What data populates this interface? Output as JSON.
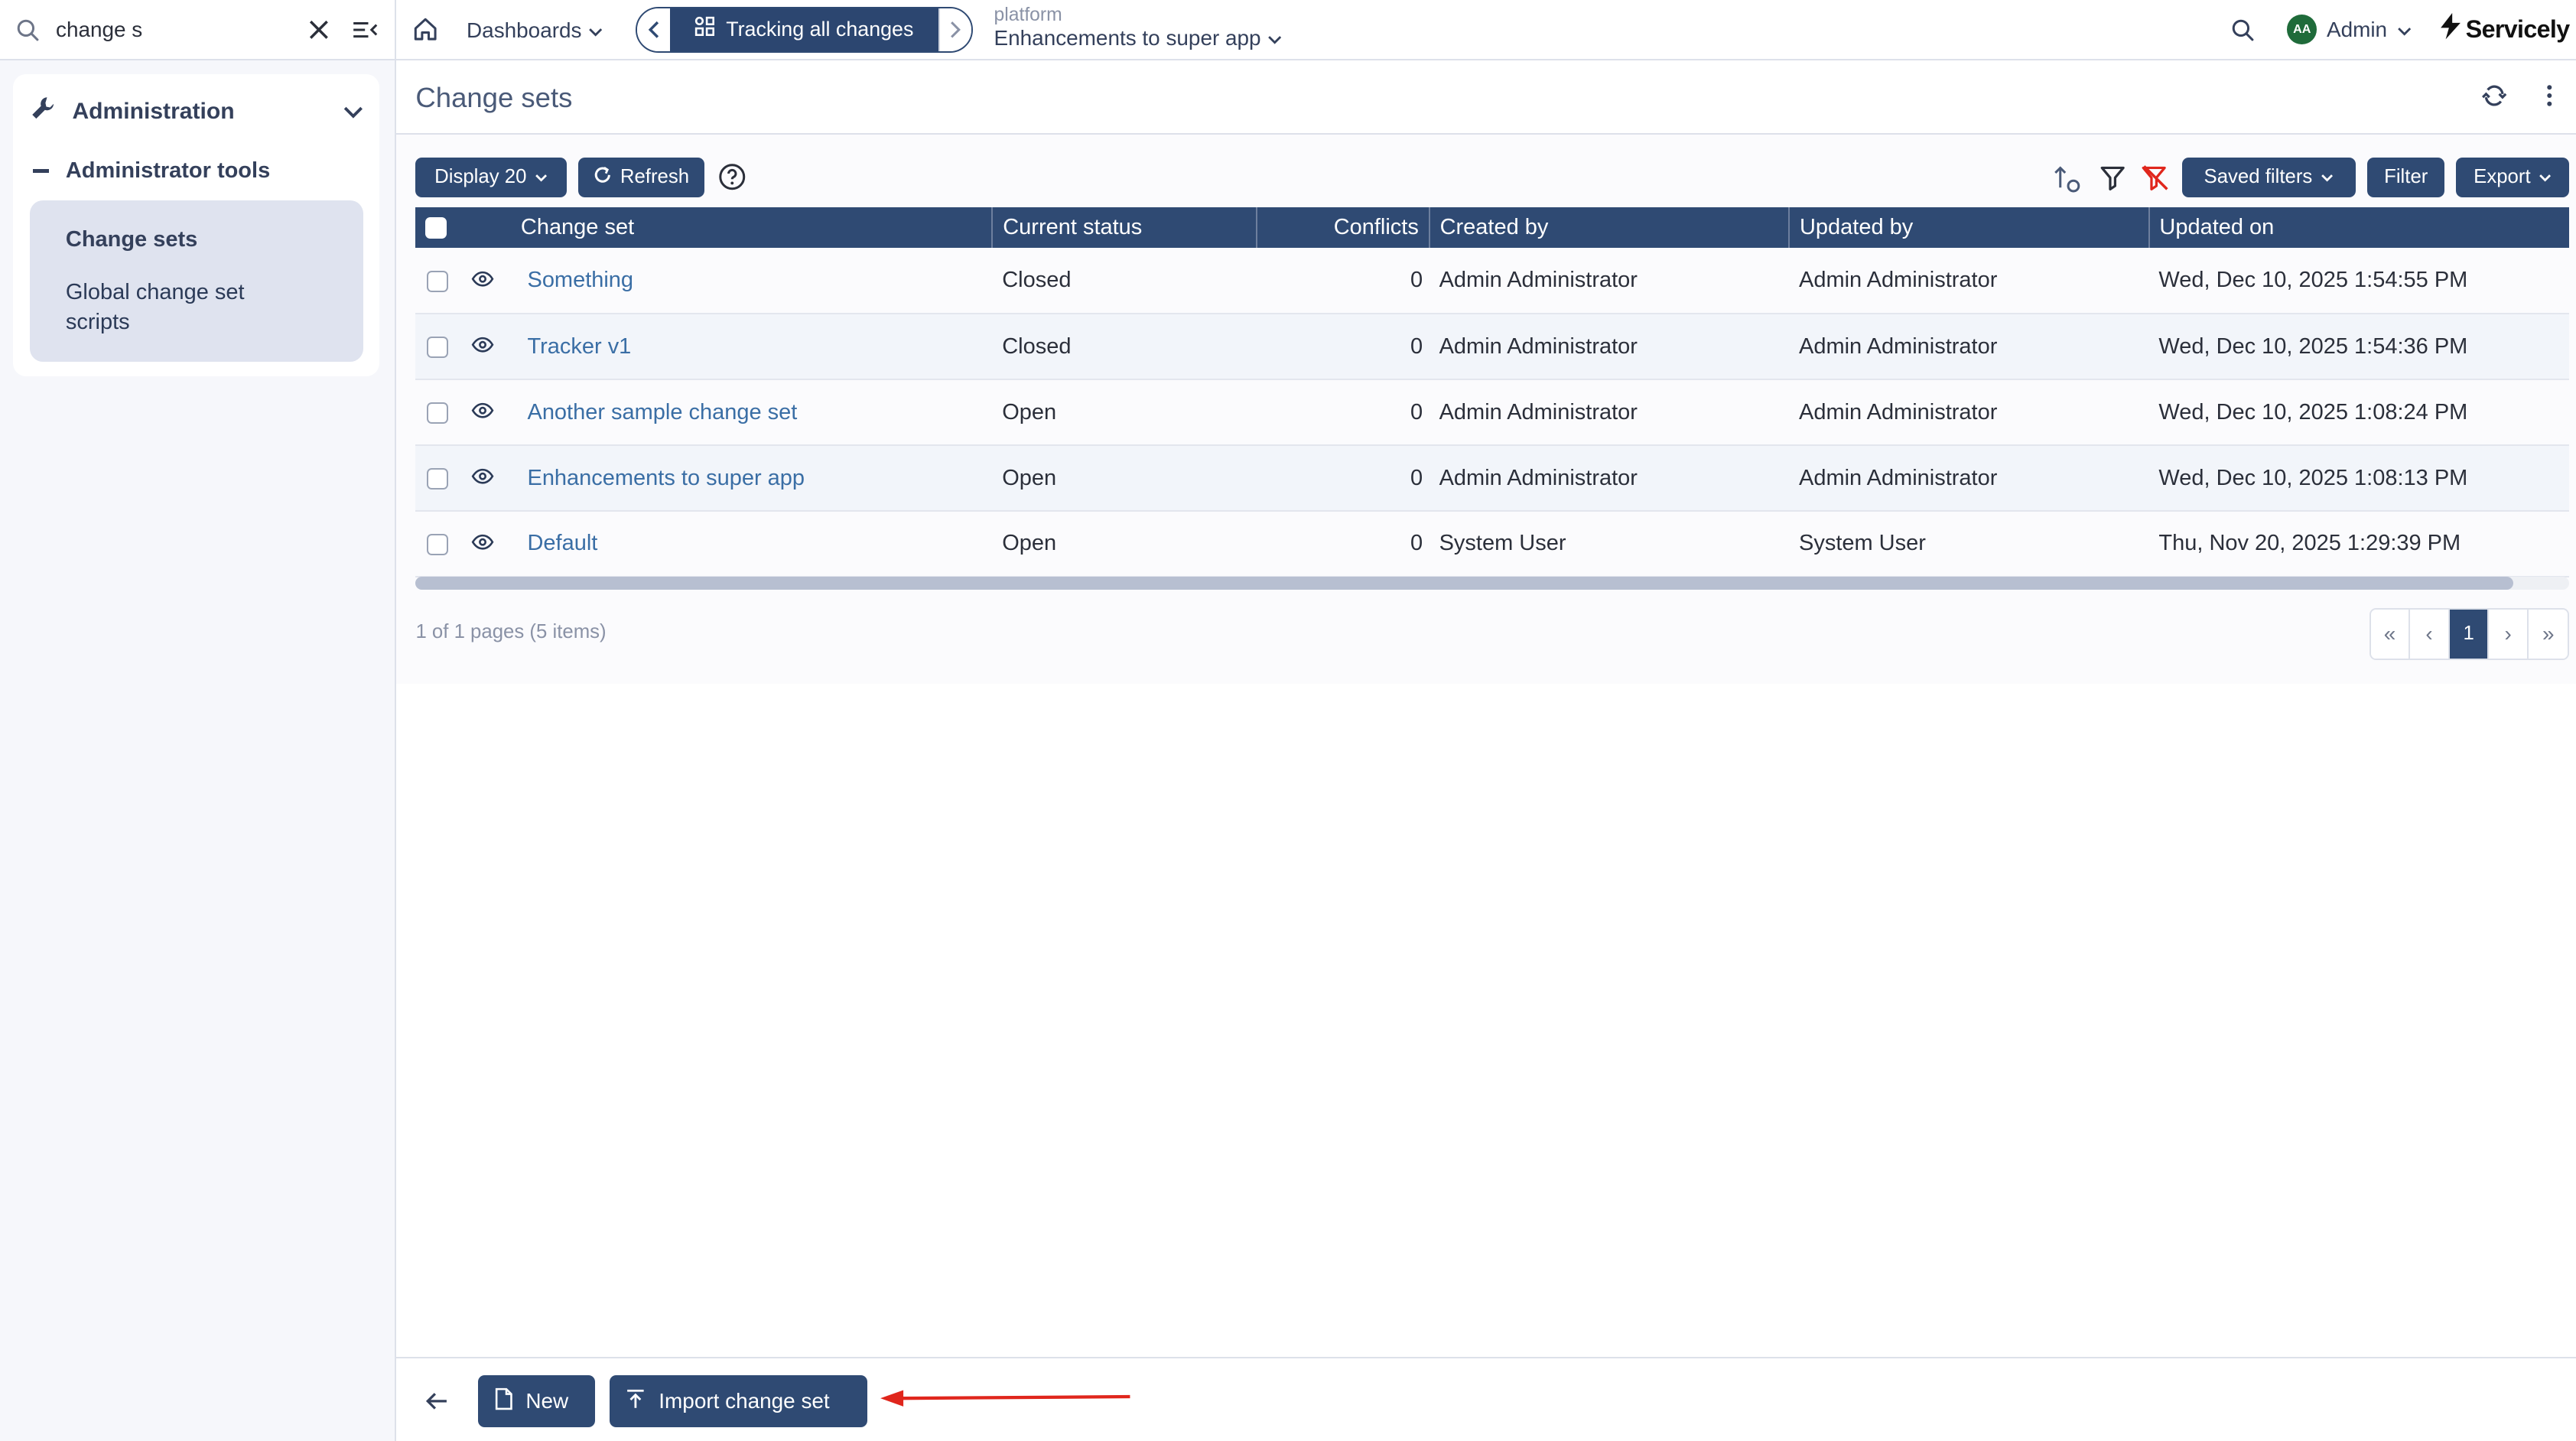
{
  "sidebar": {
    "search_value": "change s",
    "section_label": "Administration",
    "group_label": "Administrator tools",
    "items": [
      {
        "label": "Change sets"
      },
      {
        "label": "Global change set scripts"
      }
    ]
  },
  "topbar": {
    "dashboards_label": "Dashboards",
    "tracker_label": "Tracking all changes",
    "context_label": "platform",
    "context_value": "Enhancements to super app",
    "user_initials": "AA",
    "user_name": "Admin",
    "brand": "Servicely"
  },
  "page": {
    "title": "Change sets"
  },
  "toolbar": {
    "display_label": "Display 20",
    "refresh_label": "Refresh",
    "saved_filters_label": "Saved filters",
    "filter_label": "Filter",
    "export_label": "Export"
  },
  "table": {
    "columns": [
      "Change set",
      "Current status",
      "Conflicts",
      "Created by",
      "Updated by",
      "Updated on"
    ],
    "rows": [
      {
        "name": "Something",
        "status": "Closed",
        "conflicts": "0",
        "created_by": "Admin Administrator",
        "updated_by": "Admin Administrator",
        "updated_on": "Wed, Dec 10, 2025 1:54:55 PM"
      },
      {
        "name": "Tracker v1",
        "status": "Closed",
        "conflicts": "0",
        "created_by": "Admin Administrator",
        "updated_by": "Admin Administrator",
        "updated_on": "Wed, Dec 10, 2025 1:54:36 PM"
      },
      {
        "name": "Another sample change set",
        "status": "Open",
        "conflicts": "0",
        "created_by": "Admin Administrator",
        "updated_by": "Admin Administrator",
        "updated_on": "Wed, Dec 10, 2025 1:08:24 PM"
      },
      {
        "name": "Enhancements to super app",
        "status": "Open",
        "conflicts": "0",
        "created_by": "Admin Administrator",
        "updated_by": "Admin Administrator",
        "updated_on": "Wed, Dec 10, 2025 1:08:13 PM"
      },
      {
        "name": "Default",
        "status": "Open",
        "conflicts": "0",
        "created_by": "System User",
        "updated_by": "System User",
        "updated_on": "Thu, Nov 20, 2025 1:29:39 PM"
      }
    ]
  },
  "pagination": {
    "summary": "1 of 1 pages (5 items)",
    "current_page": "1"
  },
  "footer": {
    "new_label": "New",
    "import_label": "Import change set"
  },
  "colors": {
    "primary": "#2f4a73",
    "link": "#3a6ea5",
    "annotation_arrow": "#e0261c"
  }
}
